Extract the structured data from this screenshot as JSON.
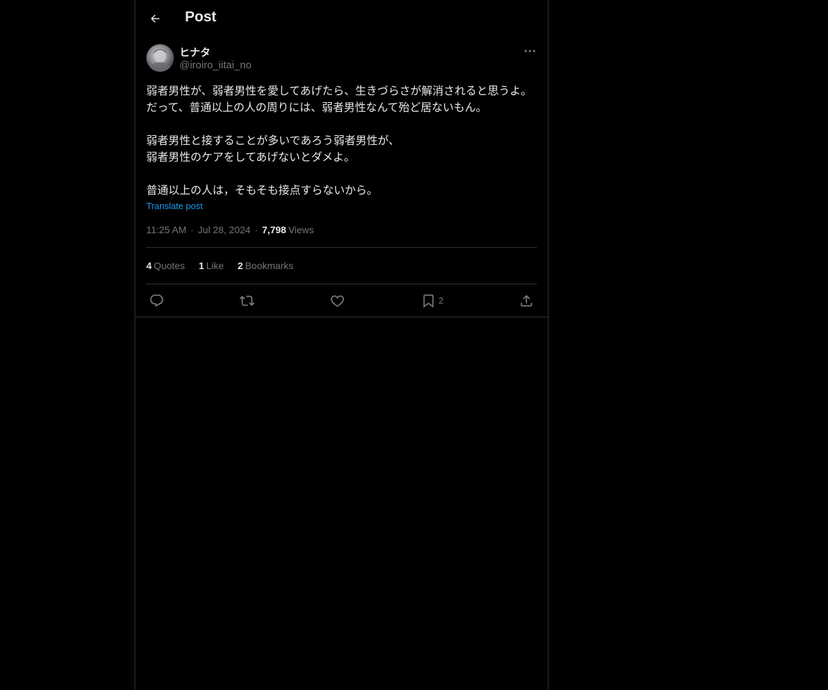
{
  "header": {
    "title": "Post",
    "back_icon": "arrow-left-icon"
  },
  "author": {
    "name": "ヒナタ",
    "handle": "@iroiro_iitai_no"
  },
  "post": {
    "text": "弱者男性が、弱者男性を愛してあげたら、生きづらさが解消されると思うよ。\nだって、普通以上の人の周りには、弱者男性なんて殆ど居ないもん。\n\n弱者男性と接することが多いであろう弱者男性が、\n弱者男性のケアをしてあげないとダメよ。\n\n普通以上の人は，そもそも接点すらないから。",
    "translate_label": "Translate post",
    "time": "11:25 AM",
    "date": "Jul 28, 2024",
    "views_count": "7,798",
    "views_label": "Views"
  },
  "stats": {
    "quotes_count": "4",
    "quotes_label": "Quotes",
    "likes_count": "1",
    "likes_label": "Like",
    "bookmarks_count": "2",
    "bookmarks_label": "Bookmarks"
  },
  "actions": {
    "bookmark_count": "2"
  },
  "colors": {
    "background": "#000000",
    "text": "#e7e9ea",
    "muted": "#71767b",
    "link": "#1d9bf0",
    "border": "#2f3336"
  }
}
